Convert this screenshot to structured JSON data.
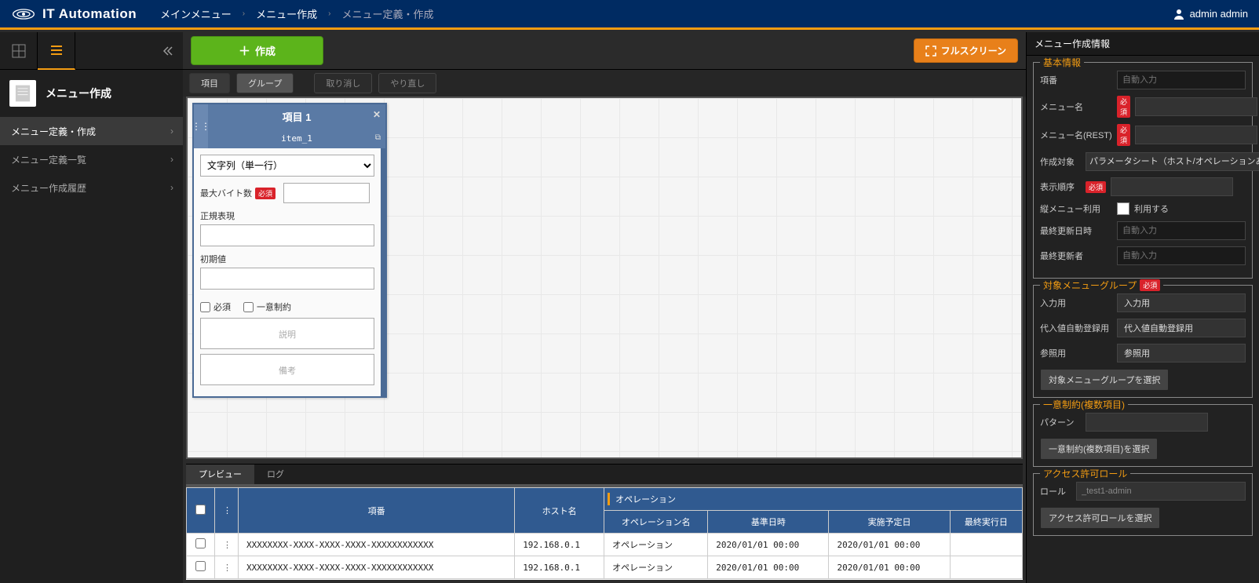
{
  "header": {
    "product": "IT Automation",
    "breadcrumb": [
      "メインメニュー",
      "メニュー作成",
      "メニュー定義・作成"
    ],
    "user": "admin admin"
  },
  "sidebar": {
    "page_title": "メニュー作成",
    "items": [
      {
        "label": "メニュー定義・作成",
        "active": true
      },
      {
        "label": "メニュー定義一覧",
        "active": false
      },
      {
        "label": "メニュー作成履歴",
        "active": false
      }
    ]
  },
  "actions": {
    "create": "作成",
    "fullscreen": "フルスクリーン"
  },
  "toolbar": {
    "item": "項目",
    "group": "グループ",
    "undo": "取り消し",
    "redo": "やり直し"
  },
  "card": {
    "title": "項目 1",
    "rest_name": "item_1",
    "type_options": [
      "文字列（単一行）"
    ],
    "max_bytes_label": "最大バイト数",
    "regex_label": "正規表現",
    "default_label": "初期値",
    "required_label": "必須",
    "unique_label": "一意制約",
    "desc_ph": "説明",
    "remarks_ph": "備考",
    "req_tag": "必須"
  },
  "bottom_tabs": {
    "preview": "プレビュー",
    "log": "ログ"
  },
  "preview": {
    "col_no": "項番",
    "col_host": "ホスト名",
    "col_op_group": "オペレーション",
    "col_op_name": "オペレーション名",
    "col_base_date": "基準日時",
    "col_sched_date": "実施予定日",
    "col_last_exec": "最終実行日",
    "rows": [
      {
        "no": "XXXXXXXX-XXXX-XXXX-XXXX-XXXXXXXXXXXX",
        "host": "192.168.0.1",
        "op": "オペレーション",
        "base": "2020/01/01 00:00",
        "sched": "2020/01/01 00:00"
      },
      {
        "no": "XXXXXXXX-XXXX-XXXX-XXXX-XXXXXXXXXXXX",
        "host": "192.168.0.1",
        "op": "オペレーション",
        "base": "2020/01/01 00:00",
        "sched": "2020/01/01 00:00"
      }
    ]
  },
  "right": {
    "panel_title": "メニュー作成情報",
    "basic": {
      "legend": "基本情報",
      "no": "項番",
      "no_ph": "自動入力",
      "name": "メニュー名",
      "rest": "メニュー名(REST)",
      "target": "作成対象",
      "target_val": "パラメータシート（ホスト/オペレーションあ",
      "order": "表示順序",
      "vmenu": "縦メニュー利用",
      "vmenu_use": "利用する",
      "updated": "最終更新日時",
      "updated_ph": "自動入力",
      "updater": "最終更新者",
      "updater_ph": "自動入力"
    },
    "group": {
      "legend": "対象メニューグループ",
      "input": "入力用",
      "input_val": "入力用",
      "subst": "代入値自動登録用",
      "subst_val": "代入値自動登録用",
      "ref": "参照用",
      "ref_val": "参照用",
      "btn": "対象メニューグループを選択"
    },
    "unique": {
      "legend": "一意制約(複数項目)",
      "pattern": "パターン",
      "btn": "一意制約(複数項目)を選択"
    },
    "role": {
      "legend": "アクセス許可ロール",
      "label": "ロール",
      "value": "_test1-admin",
      "btn": "アクセス許可ロールを選択"
    },
    "req_tag": "必須"
  }
}
